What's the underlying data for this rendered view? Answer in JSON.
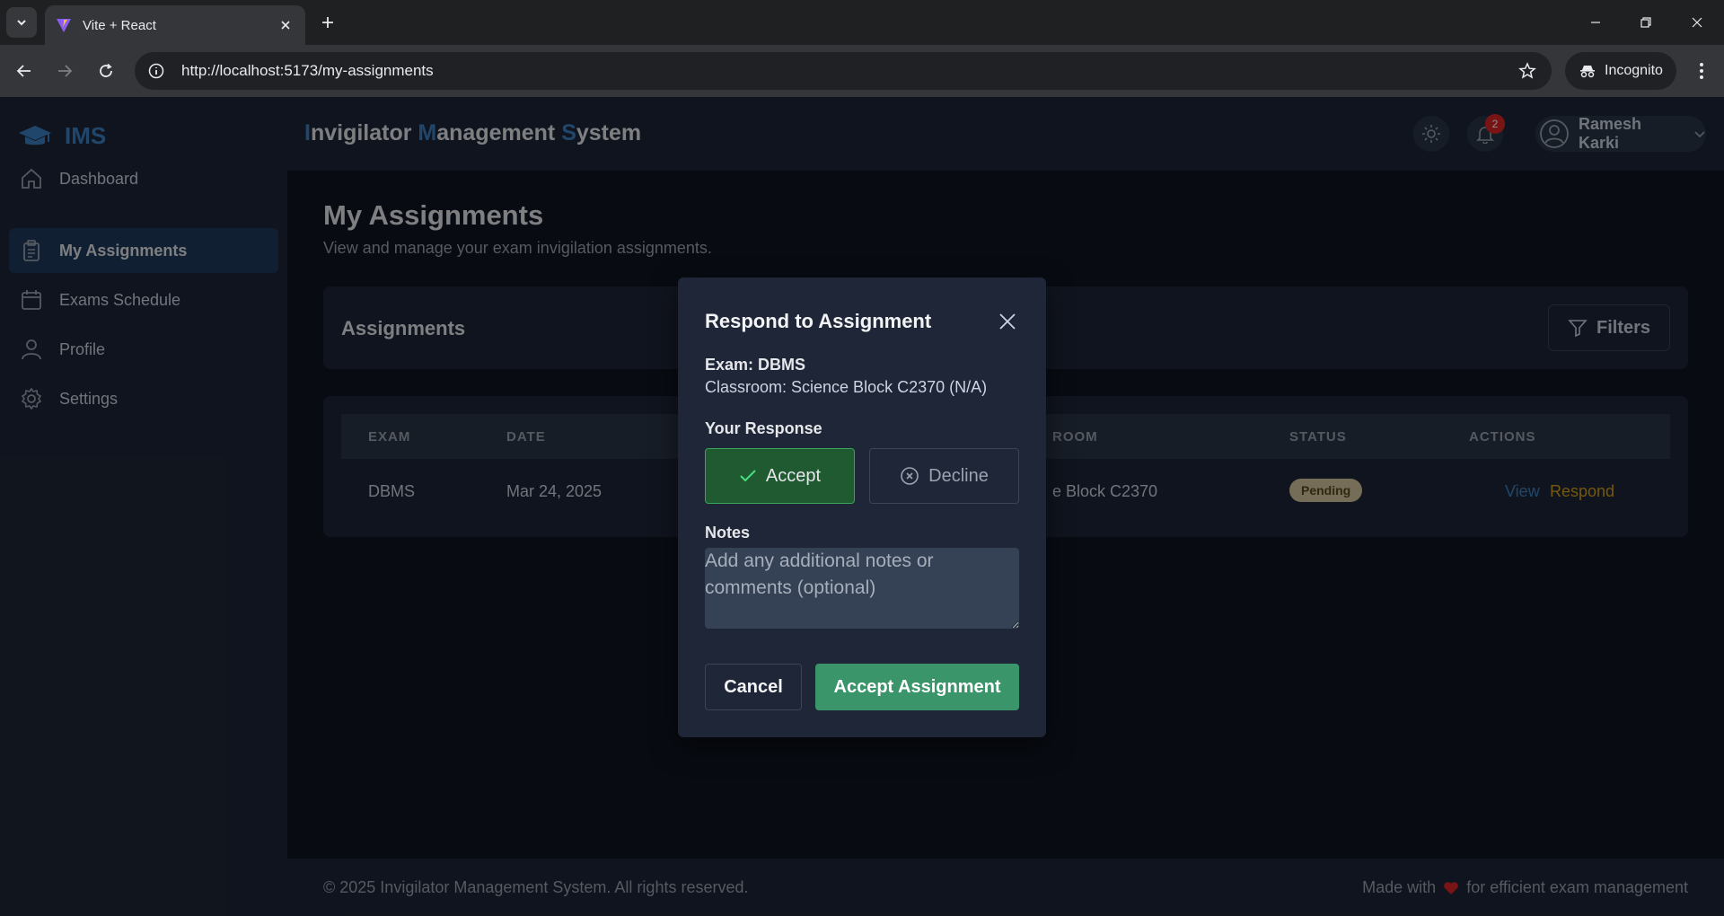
{
  "browser": {
    "tab_title": "Vite + React",
    "url": "http://localhost:5173/my-assignments",
    "incognito_label": "Incognito"
  },
  "brand": {
    "name": "IMS",
    "accent": "#3b82c4"
  },
  "app_title": {
    "p1": "I",
    "p2": "nvigilator ",
    "p3": "M",
    "p4": "anagement ",
    "p5": "S",
    "p6": "ystem"
  },
  "sidebar": {
    "items": [
      {
        "label": "Dashboard",
        "icon": "home-icon"
      },
      {
        "label": "My Assignments",
        "icon": "clipboard-icon",
        "active": true
      },
      {
        "label": "Exams Schedule",
        "icon": "calendar-icon"
      },
      {
        "label": "Profile",
        "icon": "user-icon"
      },
      {
        "label": "Settings",
        "icon": "gear-icon"
      }
    ]
  },
  "header": {
    "notification_count": "2",
    "user_name": "Ramesh Karki"
  },
  "page": {
    "title": "My Assignments",
    "subtitle": "View and manage your exam invigilation assignments."
  },
  "assignments_card": {
    "title": "Assignments",
    "filters_label": "Filters"
  },
  "table": {
    "headers": [
      "EXAM",
      "DATE",
      "ROOM",
      "STATUS",
      "ACTIONS"
    ],
    "rows": [
      {
        "exam": "DBMS",
        "date": "Mar 24, 2025",
        "room_visible": "e Block C2370",
        "status": "Pending",
        "view_label": "View",
        "respond_label": "Respond"
      }
    ]
  },
  "modal": {
    "title": "Respond to Assignment",
    "exam": "Exam: DBMS",
    "classroom": "Classroom: Science Block C2370 (N/A)",
    "response_label": "Your Response",
    "accept_label": "Accept",
    "decline_label": "Decline",
    "selected": "Accept",
    "notes_label": "Notes",
    "notes_placeholder": "Add any additional notes or comments (optional)",
    "notes_value": "",
    "cancel_label": "Cancel",
    "submit_label": "Accept Assignment"
  },
  "footer": {
    "copyright": "© 2025 Invigilator Management System. All rights reserved.",
    "made_with": "Made with",
    "made_for": "for efficient exam management"
  },
  "colors": {
    "status_pending_bg": "#d6c7a1",
    "accept_green": "#3b956a",
    "respond_link": "#d4a017",
    "view_link": "#3b82c4",
    "notification_badge": "#dc2626"
  }
}
